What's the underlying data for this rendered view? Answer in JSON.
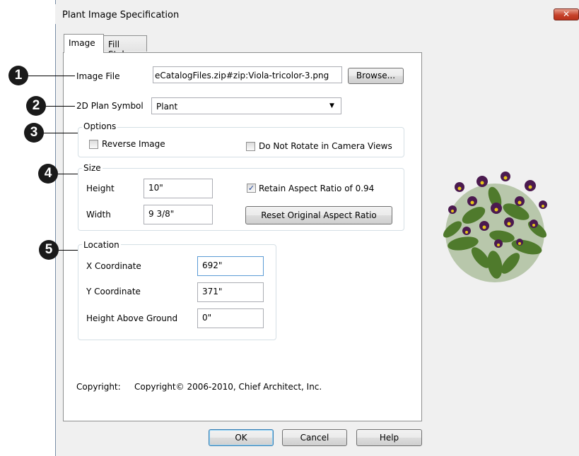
{
  "dialog": {
    "title": "Plant Image Specification",
    "close_label": "✕"
  },
  "tabs": [
    {
      "label": "Image"
    },
    {
      "label": "Fill Style"
    }
  ],
  "callouts": [
    "1",
    "2",
    "3",
    "4",
    "5"
  ],
  "image_file": {
    "label": "Image File",
    "value": "eCatalogFiles.zip#zip:Viola-tricolor-3.png",
    "browse_label": "Browse..."
  },
  "plan_symbol": {
    "label": "2D Plan Symbol",
    "value": "Plant"
  },
  "options": {
    "title": "Options",
    "reverse_image": {
      "label": "Reverse Image",
      "checked": false
    },
    "do_not_rotate": {
      "label": "Do Not Rotate in Camera Views",
      "checked": false
    }
  },
  "size": {
    "title": "Size",
    "height_label": "Height",
    "height_value": "10\"",
    "width_label": "Width",
    "width_value": "9 3/8\"",
    "retain_label": "Retain Aspect Ratio of 0.94",
    "retain_checked": true,
    "reset_label": "Reset Original Aspect Ratio"
  },
  "location": {
    "title": "Location",
    "x_label": "X Coordinate",
    "x_value": "692\"",
    "y_label": "Y Coordinate",
    "y_value": "371\"",
    "h_label": "Height Above Ground",
    "h_value": "0\""
  },
  "copyright": {
    "label": "Copyright:",
    "value": "Copyright© 2006-2010, Chief Architect, Inc."
  },
  "footer": {
    "ok_label": "OK",
    "cancel_label": "Cancel",
    "help_label": "Help"
  },
  "colors": {
    "flower_purple": "#4b1a4f",
    "flower_yellow": "#e7c51a",
    "leaf_green": "#4f7a2c"
  }
}
